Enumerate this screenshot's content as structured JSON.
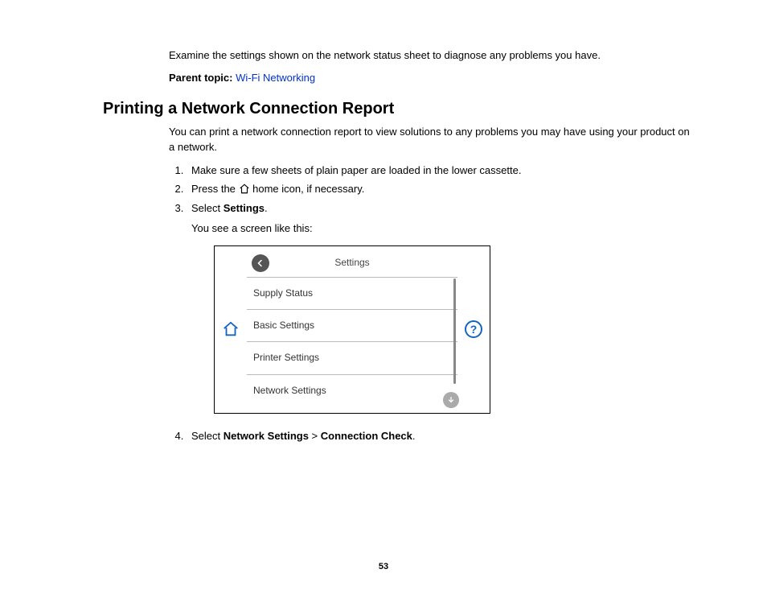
{
  "intro": {
    "examine_text": "Examine the settings shown on the network status sheet to diagnose any problems you have.",
    "parent_label": "Parent topic:",
    "parent_link": "Wi-Fi Networking"
  },
  "section": {
    "title": "Printing a Network Connection Report",
    "desc": "You can print a network connection report to view solutions to any problems you may have using your product on a network."
  },
  "steps": {
    "s1": "Make sure a few sheets of plain paper are loaded in the lower cassette.",
    "s2a": "Press the ",
    "s2b": " home icon, if necessary.",
    "s3a": "Select ",
    "s3b": "Settings",
    "s3c": ".",
    "s3_sub": "You see a screen like this:",
    "s4a": "Select ",
    "s4b": "Network Settings",
    "s4c": " > ",
    "s4d": "Connection Check",
    "s4e": "."
  },
  "lcd": {
    "title": "Settings",
    "items": [
      "Supply Status",
      "Basic Settings",
      "Printer Settings",
      "Network Settings"
    ]
  },
  "page_number": "53"
}
